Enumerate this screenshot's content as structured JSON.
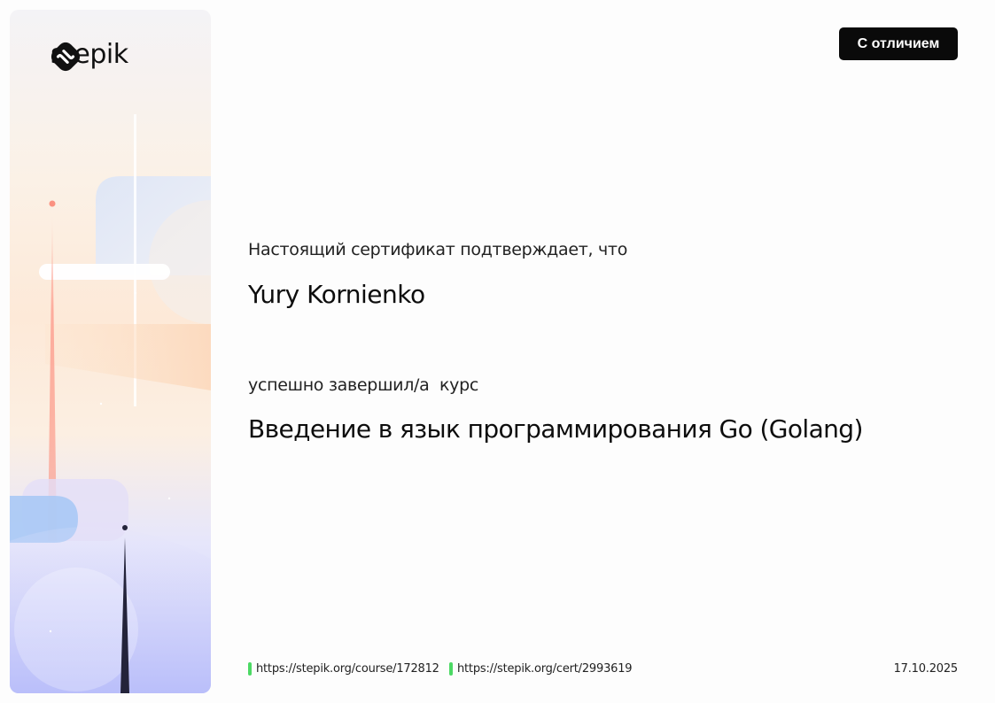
{
  "brand": {
    "name": "stepik"
  },
  "badge": {
    "label": "С отличием"
  },
  "certificate": {
    "lead_text": "Настоящий сертификат подтверждает, что",
    "student_name": "Yury Kornienko",
    "completed_text": "успешно завершил/а  курс",
    "course_title": "Введение в язык программирования Go (Golang)"
  },
  "footer": {
    "course_url": "https://stepik.org/course/172812",
    "cert_url": "https://stepik.org/cert/2993619",
    "date": "17.10.2025",
    "link_marker_color": "#4cd964"
  },
  "theme": {
    "badge_bg": "#0a0a0a",
    "badge_text": "#ffffff",
    "decor_peach": "#fde9d8",
    "decor_blue": "#a9c9f5",
    "decor_lavender": "#c3c7fb",
    "decor_coral": "#fda596"
  },
  "icons": {
    "logo": "stepik-logo-icon",
    "link_marker": "green-bar-icon"
  }
}
